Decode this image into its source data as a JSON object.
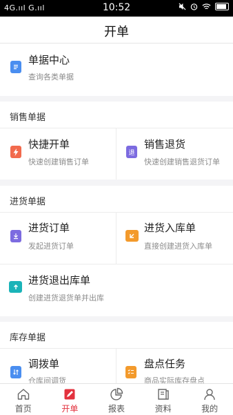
{
  "status": {
    "signal": "4G.ııl G.ııl",
    "time": "10:52"
  },
  "header": {
    "title": "开单"
  },
  "top_item": {
    "title": "单据中心",
    "subtitle": "查询各类单据"
  },
  "sections": [
    {
      "label": "销售单据",
      "items": [
        {
          "title": "快捷开单",
          "subtitle": "快速创建销售订单",
          "icon": "bolt-icon",
          "color": "#f26a4d"
        },
        {
          "title": "销售退货",
          "subtitle": "快速创建销售退货订单",
          "icon": "return-icon",
          "icon_char": "退",
          "color": "#7c6be0"
        }
      ]
    },
    {
      "label": "进货单据",
      "items": [
        {
          "title": "进货订单",
          "subtitle": "发起进货订单",
          "icon": "download-icon",
          "color": "#7c6be0"
        },
        {
          "title": "进货入库单",
          "subtitle": "直接创建进货入库单",
          "icon": "box-in-icon",
          "color": "#f39a2c"
        },
        {
          "title": "进货退出库单",
          "subtitle": "创建进货退货单并出库",
          "icon": "box-out-icon",
          "color": "#1ab3b8"
        }
      ]
    },
    {
      "label": "库存单据",
      "items": [
        {
          "title": "调拨单",
          "subtitle": "仓库间调货",
          "icon": "transfer-icon",
          "color": "#4a8ef0"
        },
        {
          "title": "盘点任务",
          "subtitle": "商品实际库存盘点",
          "icon": "checklist-icon",
          "color": "#f39a2c"
        }
      ]
    }
  ],
  "tabs": [
    {
      "label": "首页",
      "icon": "home-icon"
    },
    {
      "label": "开单",
      "icon": "pen-icon",
      "active": true
    },
    {
      "label": "报表",
      "icon": "pie-chart-icon"
    },
    {
      "label": "资料",
      "icon": "book-icon"
    },
    {
      "label": "我的",
      "icon": "user-icon"
    }
  ],
  "colors": {
    "accent": "#e3323e",
    "doc_icon": "#4a8ef0"
  }
}
